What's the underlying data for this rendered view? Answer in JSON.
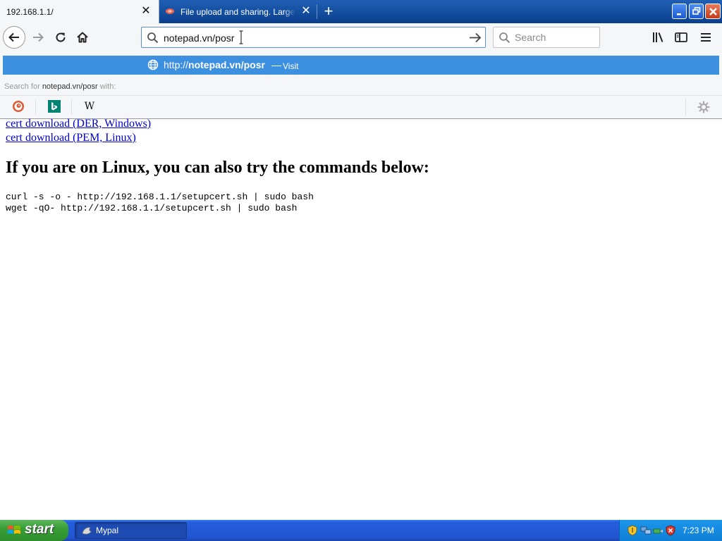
{
  "browser": {
    "tabs": [
      {
        "title": "192.168.1.1/",
        "active": true
      },
      {
        "title": "File upload and sharing. Large file transfers.",
        "active": false
      }
    ],
    "url_input_value": "notepad.vn/posr",
    "search_placeholder": "Search",
    "dropdown": {
      "suggestion_prefix": "http://",
      "suggestion_domain": "notepad.vn/posr",
      "suggestion_separator": "—",
      "suggestion_action": "Visit",
      "search_for_prefix": "Search for ",
      "search_for_query": "notepad.vn/posr",
      "search_for_suffix": " with:",
      "engines": [
        "duckduckgo-icon",
        "bing-icon",
        "wikipedia-icon"
      ],
      "wiki_glyph": "W"
    }
  },
  "page": {
    "links": [
      "cert download (DER, Windows)",
      "cert download (PEM, Linux)"
    ],
    "heading": "If you are on Linux, you can also try the commands below:",
    "commands": [
      "curl -s -o - http://192.168.1.1/setupcert.sh | sudo bash",
      "wget -qO- http://192.168.1.1/setupcert.sh | sudo bash"
    ]
  },
  "taskbar": {
    "start_label": "start",
    "task_label": "Mypal",
    "clock": "7:23 PM"
  },
  "colors": {
    "accent": "#3d8fe0",
    "tabbar": "#1f5fb4",
    "start": "#379f35",
    "taskbar": "#245edc"
  }
}
